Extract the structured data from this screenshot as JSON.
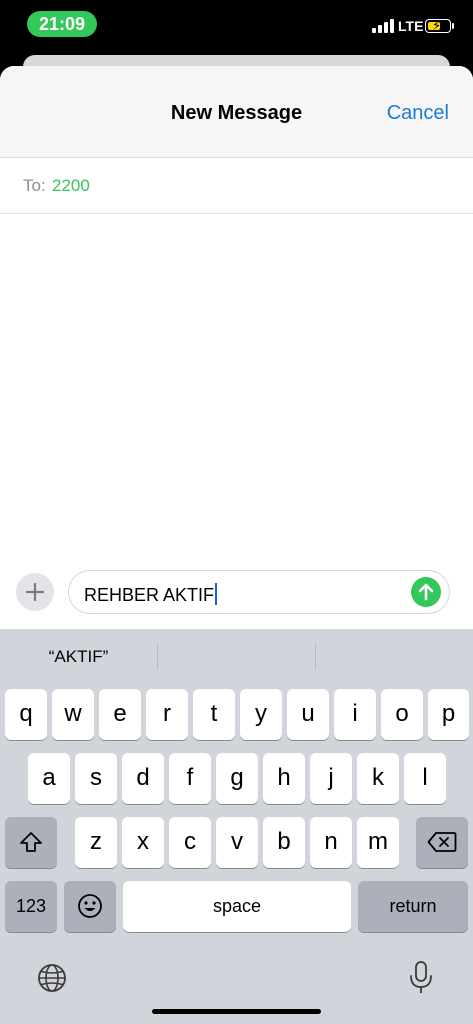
{
  "status_bar": {
    "time": "21:09",
    "network": "LTE",
    "accent": "#34c759"
  },
  "header": {
    "title": "New Message",
    "cancel_label": "Cancel"
  },
  "recipient": {
    "label": "To:",
    "value": "2200"
  },
  "composer": {
    "text": "REHBER AKTIF",
    "plus_icon": "plus-icon",
    "send_icon": "arrow-up-icon"
  },
  "suggestions": [
    "“AKTIF”",
    "",
    ""
  ],
  "keyboard": {
    "row1": [
      "q",
      "w",
      "e",
      "r",
      "t",
      "y",
      "u",
      "i",
      "o",
      "p"
    ],
    "row2": [
      "a",
      "s",
      "d",
      "f",
      "g",
      "h",
      "j",
      "k",
      "l"
    ],
    "row3": [
      "z",
      "x",
      "c",
      "v",
      "b",
      "n",
      "m"
    ],
    "numbers_label": "123",
    "space_label": "space",
    "return_label": "return",
    "shift_icon": "shift-icon",
    "delete_icon": "delete-icon",
    "emoji_icon": "emoji-icon",
    "globe_icon": "globe-icon",
    "mic_icon": "microphone-icon"
  }
}
